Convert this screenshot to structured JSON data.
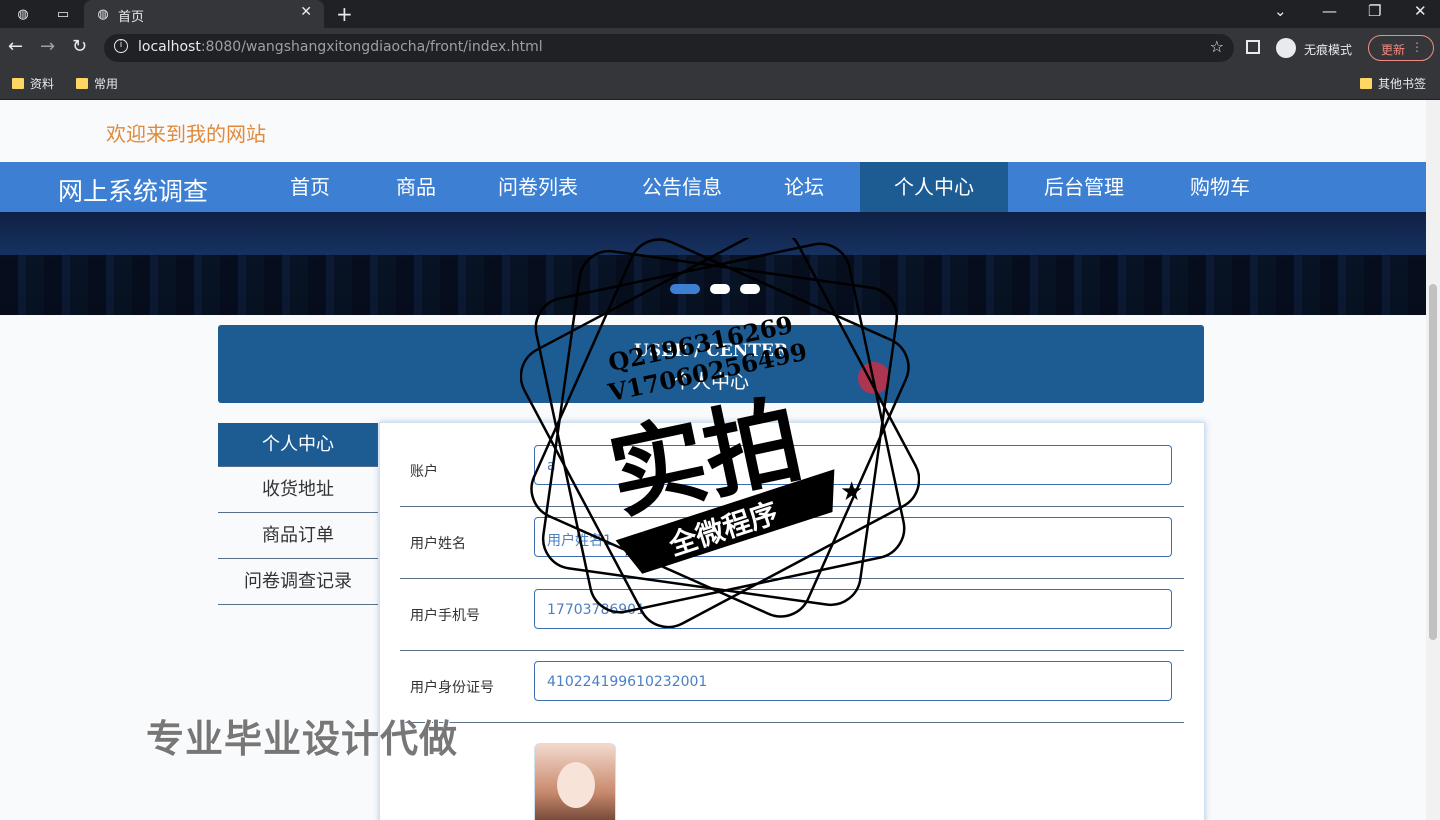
{
  "browser": {
    "tab_title": "首页",
    "url_host": "localhost",
    "url_rest": ":8080/wangshangxitongdiaocha/front/index.html",
    "incognito_label": "无痕模式",
    "update_label": "更新",
    "bookmarks": [
      "资料",
      "常用"
    ],
    "other_bookmarks": "其他书签"
  },
  "page": {
    "welcome": "欢迎来到我的网站",
    "brand": "网上系统调查",
    "nav": [
      "首页",
      "商品",
      "问卷列表",
      "公告信息",
      "论坛",
      "个人中心",
      "后台管理",
      "购物车"
    ],
    "active_nav_index": 5,
    "uc_en": "USER / CENTER",
    "uc_zh": "个人中心",
    "side_menu": [
      "个人中心",
      "收货地址",
      "商品订单",
      "问卷调查记录"
    ],
    "form": {
      "account_label": "账户",
      "account_value": "a",
      "name_label": "用户姓名",
      "name_value": "用户姓名1",
      "phone_label": "用户手机号",
      "phone_value": "17703786901",
      "id_label": "用户身份证号",
      "id_value": "410224199610232001"
    }
  },
  "watermark": {
    "contact1": "Q2196316269",
    "contact2": "V17060256499",
    "big": "实拍",
    "ribbon": "全微程序",
    "bottom": "专业毕业设计代做"
  },
  "colors": {
    "nav_blue": "#3d7fd3",
    "dark_blue": "#1c5c93",
    "welcome_orange": "#e08a3c"
  }
}
